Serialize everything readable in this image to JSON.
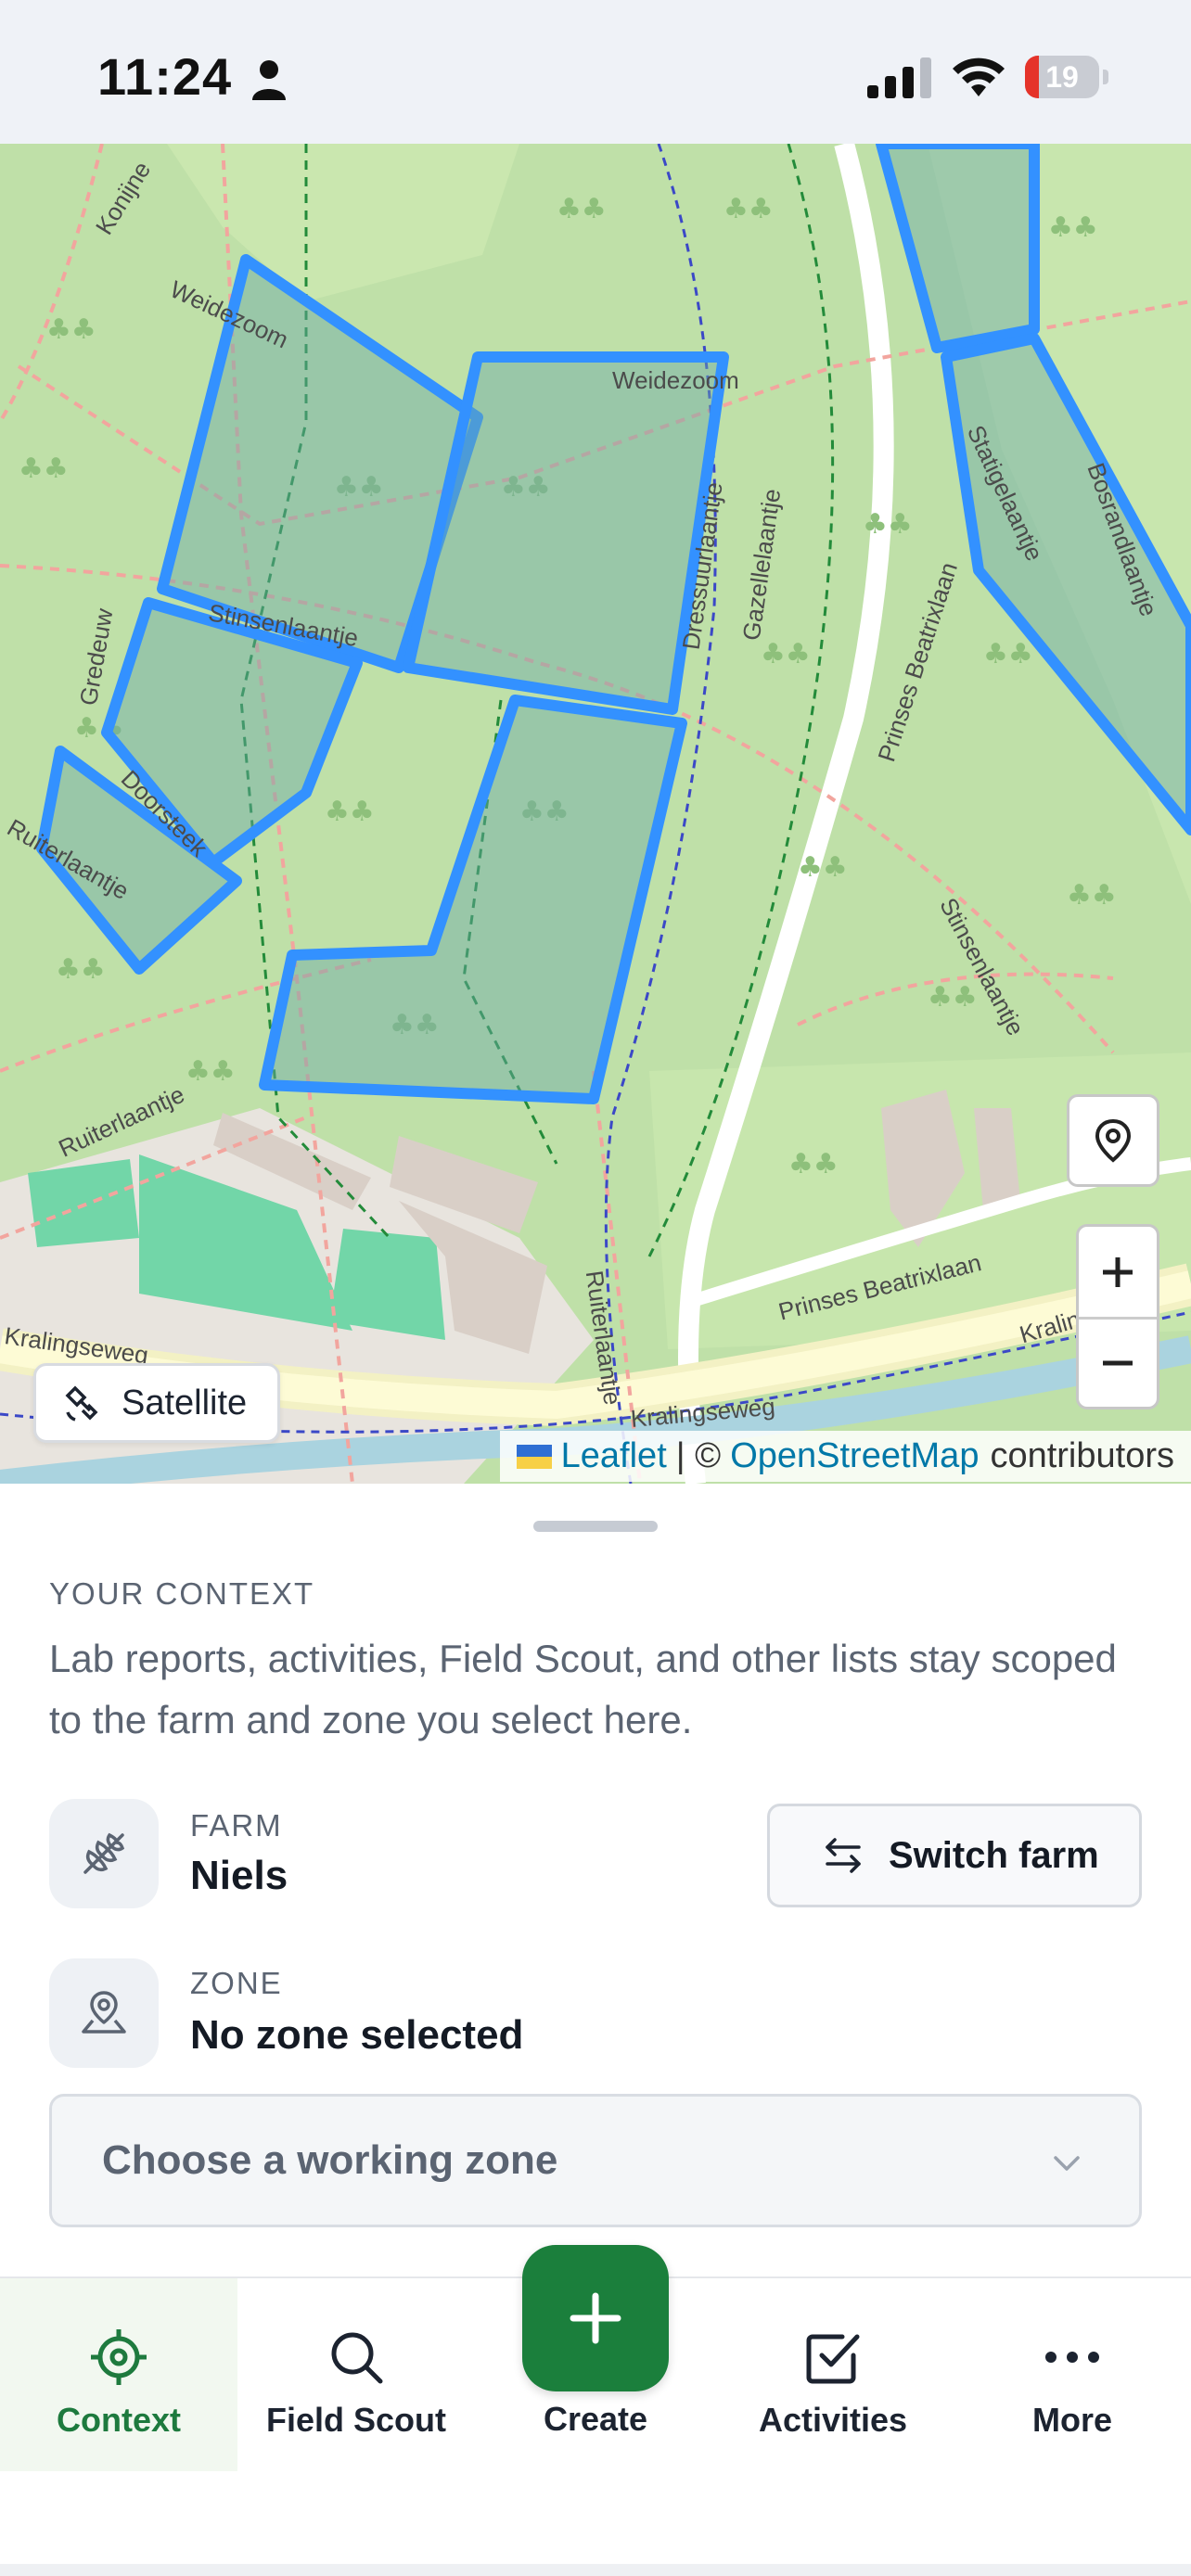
{
  "status_bar": {
    "time": "11:24",
    "battery_level": "19",
    "battery_fraction": 0.19,
    "icons": [
      "person-icon",
      "signal-icon",
      "wifi-icon",
      "battery-icon"
    ]
  },
  "map": {
    "street_labels": [
      "Konijne",
      "Weidezoom",
      "Weidezoom",
      "Stinsenlaantje",
      "Dressuurlaantje",
      "Gazellelaantje",
      "Prinses Beatrixlaan",
      "Statigelaantje",
      "Bosrandlaantje",
      "Ruiterlaantje",
      "Doorsteek",
      "Ruiterlaantje",
      "Prinses Beatrixlaan",
      "Stinsenlaantje",
      "Ruiterlaantje",
      "Kralingseweg",
      "Kralingse",
      "Kralingseweg",
      "Gredeuw"
    ],
    "satellite_label": "Satellite",
    "attribution": {
      "leaflet": "Leaflet",
      "separator": "| ©",
      "osm": "OpenStreetMap",
      "suffix": "contributors"
    },
    "controls": [
      "locate-icon",
      "zoom-in-icon",
      "zoom-out-icon"
    ]
  },
  "context_sheet": {
    "heading": "YOUR CONTEXT",
    "description": "Lab reports, activities, Field Scout, and other lists stay scoped to the farm and zone you select here.",
    "farm": {
      "label": "FARM",
      "value": "Niels",
      "icon": "wheat-icon"
    },
    "switch_farm_label": "Switch farm",
    "zone": {
      "label": "ZONE",
      "value": "No zone selected",
      "icon": "map-pin-icon"
    },
    "zone_select_placeholder": "Choose a working zone"
  },
  "tab_bar": {
    "tabs": [
      {
        "label": "Context",
        "icon": "target-icon",
        "active": true
      },
      {
        "label": "Field Scout",
        "icon": "search-icon",
        "active": false
      },
      {
        "label": "Create",
        "icon": "plus-icon",
        "active": false
      },
      {
        "label": "Activities",
        "icon": "checkbox-icon",
        "active": false
      },
      {
        "label": "More",
        "icon": "more-icon",
        "active": false
      }
    ]
  },
  "colors": {
    "accent_green": "#1b7f3c",
    "zone_outline_blue": "#3391ff",
    "muted_text": "#5b6472",
    "map_base_green": "#bfe0a8"
  }
}
